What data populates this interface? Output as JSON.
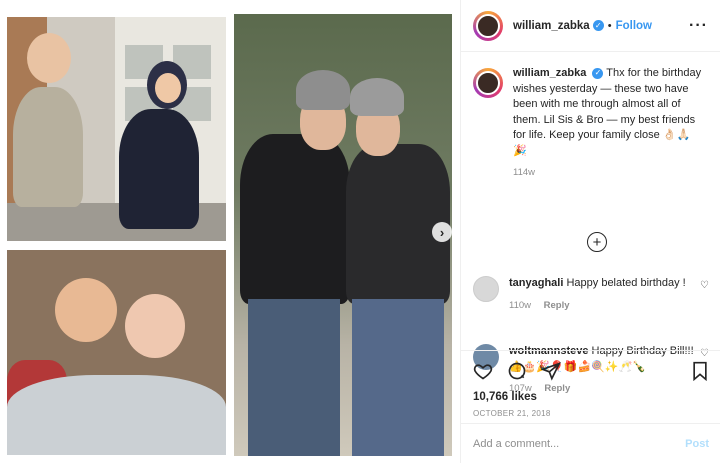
{
  "post": {
    "username": "william_zabka",
    "follow_label": "Follow",
    "dot": "•",
    "more_label": "···",
    "caption_text": "Thx for the birthday wishes yesterday — these two have been with me through almost all of them. Lil Sis & Bro — my best friends for life. Keep your family close 👌🏻🙏🏻🎉",
    "caption_time": "114w",
    "likes": "10,766 likes",
    "date": "OCTOBER 21, 2018",
    "add_comment_placeholder": "Add a comment...",
    "post_label": "Post"
  },
  "comments": [
    {
      "username": "tanyaghali",
      "text": "Happy belated birthday !",
      "time": "110w",
      "reply_label": "Reply"
    },
    {
      "username": "woltmannsteve",
      "text": "Happy Birthday Bill!!!👍🎂🎉🎈🎁🍰🍭✨🥂🍾",
      "time": "107w",
      "reply_label": "Reply"
    }
  ],
  "icons": {
    "verified": "verified-badge-icon",
    "heart": "heart-icon",
    "comment": "comment-icon",
    "share": "share-icon",
    "bookmark": "bookmark-icon",
    "load_more": "plus-circle-icon",
    "next": "chevron-right-icon"
  },
  "colors": {
    "accent": "#3897f0",
    "muted": "#8e8e8e",
    "post_disabled": "#b2dffc",
    "text": "#262626"
  }
}
